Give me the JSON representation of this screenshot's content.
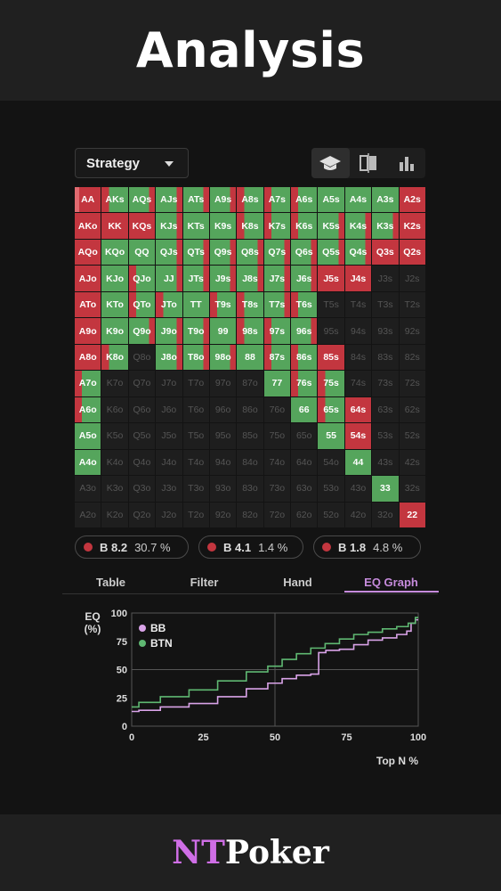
{
  "header": {
    "title": "Analysis"
  },
  "footer": {
    "brand_nt": "NT",
    "brand_poker": "Poker"
  },
  "toolbar": {
    "strategy_label": "Strategy",
    "view_icons": [
      "graduation-cap-icon",
      "compare-icon",
      "bar-chart-icon"
    ]
  },
  "colors": {
    "raise": "#c3363f",
    "call": "#55a55c",
    "empty": "#1e1e1e",
    "accent": "#c68bdc",
    "bb": "#d9a3e8",
    "btn": "#5fb872"
  },
  "grid": {
    "rows": [
      [
        "AA",
        "AKs",
        "AQs",
        "AJs",
        "ATs",
        "A9s",
        "A8s",
        "A7s",
        "A6s",
        "A5s",
        "A4s",
        "A3s",
        "A2s"
      ],
      [
        "AKo",
        "KK",
        "KQs",
        "KJs",
        "KTs",
        "K9s",
        "K8s",
        "K7s",
        "K6s",
        "K5s",
        "K4s",
        "K3s",
        "K2s"
      ],
      [
        "AQo",
        "KQo",
        "QQ",
        "QJs",
        "QTs",
        "Q9s",
        "Q8s",
        "Q7s",
        "Q6s",
        "Q5s",
        "Q4s",
        "Q3s",
        "Q2s"
      ],
      [
        "AJo",
        "KJo",
        "QJo",
        "JJ",
        "JTs",
        "J9s",
        "J8s",
        "J7s",
        "J6s",
        "J5s",
        "J4s",
        "J3s",
        "J2s"
      ],
      [
        "ATo",
        "KTo",
        "QTo",
        "JTo",
        "TT",
        "T9s",
        "T8s",
        "T7s",
        "T6s",
        "T5s",
        "T4s",
        "T3s",
        "T2s"
      ],
      [
        "A9o",
        "K9o",
        "Q9o",
        "J9o",
        "T9o",
        "99",
        "98s",
        "97s",
        "96s",
        "95s",
        "94s",
        "93s",
        "92s"
      ],
      [
        "A8o",
        "K8o",
        "Q8o",
        "J8o",
        "T8o",
        "98o",
        "88",
        "87s",
        "86s",
        "85s",
        "84s",
        "83s",
        "82s"
      ],
      [
        "A7o",
        "K7o",
        "Q7o",
        "J7o",
        "T7o",
        "97o",
        "87o",
        "77",
        "76s",
        "75s",
        "74s",
        "73s",
        "72s"
      ],
      [
        "A6o",
        "K6o",
        "Q6o",
        "J6o",
        "T6o",
        "96o",
        "86o",
        "76o",
        "66",
        "65s",
        "64s",
        "63s",
        "62s"
      ],
      [
        "A5o",
        "K5o",
        "Q5o",
        "J5o",
        "T5o",
        "95o",
        "85o",
        "75o",
        "65o",
        "55",
        "54s",
        "53s",
        "52s"
      ],
      [
        "A4o",
        "K4o",
        "Q4o",
        "J4o",
        "T4o",
        "94o",
        "84o",
        "74o",
        "64o",
        "54o",
        "44",
        "43s",
        "42s"
      ],
      [
        "A3o",
        "K3o",
        "Q3o",
        "J3o",
        "T3o",
        "93o",
        "83o",
        "73o",
        "63o",
        "53o",
        "43o",
        "33",
        "32s"
      ],
      [
        "A2o",
        "K2o",
        "Q2o",
        "J2o",
        "T2o",
        "92o",
        "82o",
        "72o",
        "62o",
        "52o",
        "42o",
        "32o",
        "22"
      ]
    ],
    "mix": [
      [
        "rrg",
        "rg",
        "gr",
        "gr",
        "gr",
        "gr",
        "rg",
        "rg",
        "rg",
        "g",
        "g",
        "g",
        "r"
      ],
      [
        "r",
        "r",
        "r",
        "gr",
        "g",
        "g",
        "rg",
        "rg",
        "rg",
        "gr",
        "gr",
        "gr",
        "r"
      ],
      [
        "r",
        "g",
        "g",
        "gr",
        "gr",
        "gr",
        "gr",
        "gr",
        "gr",
        "gr",
        "gr",
        "r",
        "r"
      ],
      [
        "r",
        "g",
        "rg",
        "gr",
        "gr",
        "gr",
        "gr",
        "gr",
        "gr",
        "r",
        "r",
        "e",
        "e"
      ],
      [
        "r",
        "g",
        "rg",
        "rg",
        "g",
        "rg",
        "rg",
        "gr",
        "rg",
        "e",
        "e",
        "e",
        "e"
      ],
      [
        "r",
        "g",
        "gr",
        "gr",
        "gr",
        "g",
        "rg",
        "rg",
        "gr",
        "e",
        "e",
        "e",
        "e"
      ],
      [
        "r",
        "rg",
        "e",
        "gr",
        "gr",
        "gr",
        "g",
        "rg",
        "rg",
        "r",
        "e",
        "e",
        "e"
      ],
      [
        "rg",
        "e",
        "e",
        "e",
        "e",
        "e",
        "e",
        "g",
        "rg",
        "rg",
        "e",
        "e",
        "e"
      ],
      [
        "rg",
        "e",
        "e",
        "e",
        "e",
        "e",
        "e",
        "e",
        "g",
        "rg",
        "r",
        "e",
        "e"
      ],
      [
        "g",
        "e",
        "e",
        "e",
        "e",
        "e",
        "e",
        "e",
        "e",
        "g",
        "r",
        "e",
        "e"
      ],
      [
        "g",
        "e",
        "e",
        "e",
        "e",
        "e",
        "e",
        "e",
        "e",
        "e",
        "g",
        "e",
        "e"
      ],
      [
        "e",
        "e",
        "e",
        "e",
        "e",
        "e",
        "e",
        "e",
        "e",
        "e",
        "e",
        "g",
        "e"
      ],
      [
        "e",
        "e",
        "e",
        "e",
        "e",
        "e",
        "e",
        "e",
        "e",
        "e",
        "e",
        "e",
        "r"
      ]
    ]
  },
  "actions": [
    {
      "label": "B 8.2",
      "pct": "30.7 %"
    },
    {
      "label": "B 4.1",
      "pct": "1.4 %"
    },
    {
      "label": "B 1.8",
      "pct": "4.8 %"
    }
  ],
  "tabs": [
    "Table",
    "Filter",
    "Hand",
    "EQ Graph"
  ],
  "active_tab": "EQ Graph",
  "chart_data": {
    "type": "line",
    "ylabel": "EQ\n(%)",
    "xlabel": "Top N %",
    "xlim": [
      0,
      100
    ],
    "ylim": [
      0,
      100
    ],
    "xticks": [
      0,
      25,
      50,
      75,
      100
    ],
    "yticks": [
      0,
      25,
      50,
      75,
      100
    ],
    "legend": "top-left",
    "series": [
      {
        "name": "BB",
        "x": [
          0,
          5,
          15,
          25,
          35,
          45,
          50,
          55,
          60,
          65,
          65.5,
          70,
          75,
          80,
          85,
          90,
          95,
          97,
          98,
          100
        ],
        "y": [
          13,
          14,
          17,
          20,
          26,
          33,
          38,
          42,
          45,
          46,
          65,
          67,
          68,
          72,
          76,
          78,
          81,
          84,
          91,
          94
        ]
      },
      {
        "name": "BTN",
        "x": [
          0,
          5,
          15,
          25,
          35,
          45,
          50,
          55,
          60,
          65,
          70,
          75,
          80,
          85,
          90,
          95,
          98,
          100
        ],
        "y": [
          17,
          21,
          26,
          32,
          40,
          48,
          53,
          59,
          64,
          69,
          73,
          77,
          81,
          83,
          86,
          88,
          91,
          96
        ]
      }
    ]
  }
}
